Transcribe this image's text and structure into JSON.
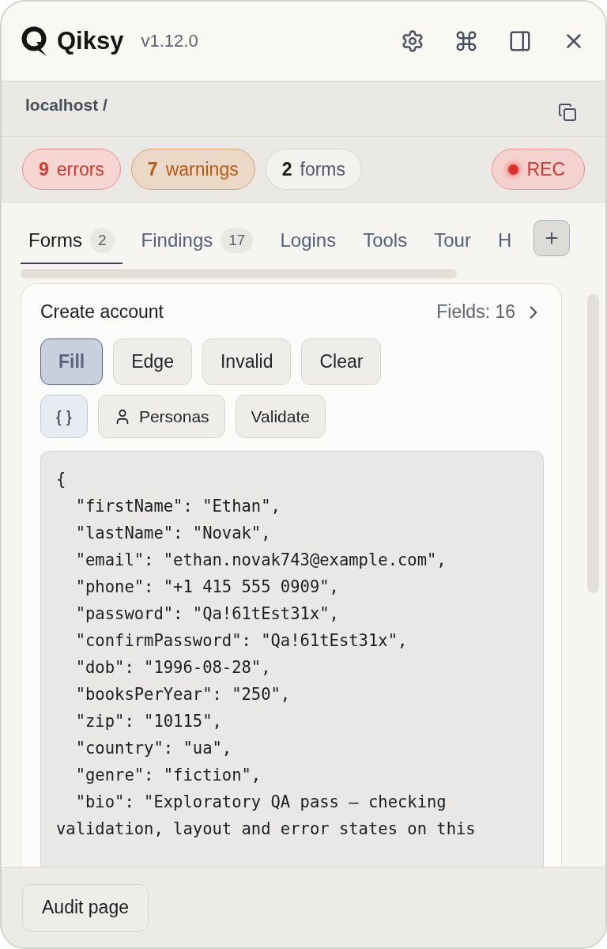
{
  "app": {
    "name": "Qiksy",
    "version": "v1.12.0"
  },
  "location": {
    "path": "localhost /"
  },
  "badges": [
    {
      "kind": "error",
      "count": "9",
      "label": "errors"
    },
    {
      "kind": "warning",
      "count": "7",
      "label": "warnings"
    },
    {
      "kind": "neutral",
      "count": "2",
      "label": "forms"
    }
  ],
  "record": {
    "label": "REC",
    "recording": true
  },
  "tabs": [
    {
      "label": "Forms",
      "count": "2",
      "selected": true
    },
    {
      "label": "Findings",
      "count": "17",
      "selected": false
    },
    {
      "label": "Logins",
      "selected": false
    },
    {
      "label": "Tools",
      "selected": false
    },
    {
      "label": "Tour",
      "selected": false
    },
    {
      "label": "H",
      "selected": false
    }
  ],
  "form": {
    "title": "Create account",
    "fields": "Fields: 16",
    "actions": [
      {
        "label": "Fill",
        "selected": true
      },
      {
        "label": "Edge",
        "selected": false
      },
      {
        "label": "Invalid",
        "selected": false
      },
      {
        "label": "Clear",
        "selected": false
      }
    ],
    "tools": [
      {
        "kind": "toggle",
        "label": "{ }",
        "selected": true
      },
      {
        "kind": "persona",
        "label": "Personas",
        "selected": false
      },
      {
        "kind": "plain",
        "label": "Validate",
        "selected": false
      }
    ],
    "json_preview": [
      "{",
      "  \"firstName\": \"Ethan\",",
      "  \"lastName\": \"Novak\",",
      "  \"email\": \"ethan.novak743@example.com\",",
      "  \"phone\": \"+1 415 555 0909\",",
      "  \"password\": \"Qa!61tEst31x\",",
      "  \"confirmPassword\": \"Qa!61tEst31x\",",
      "  \"dob\": \"1996-08-28\",",
      "  \"booksPerYear\": \"250\",",
      "  \"zip\": \"10115\",",
      "  \"country\": \"ua\",",
      "  \"genre\": \"fiction\",",
      "  \"bio\": \"Exploratory QA pass — checking",
      "validation, layout and error states on this"
    ]
  },
  "footer": {
    "button": "Audit page"
  }
}
